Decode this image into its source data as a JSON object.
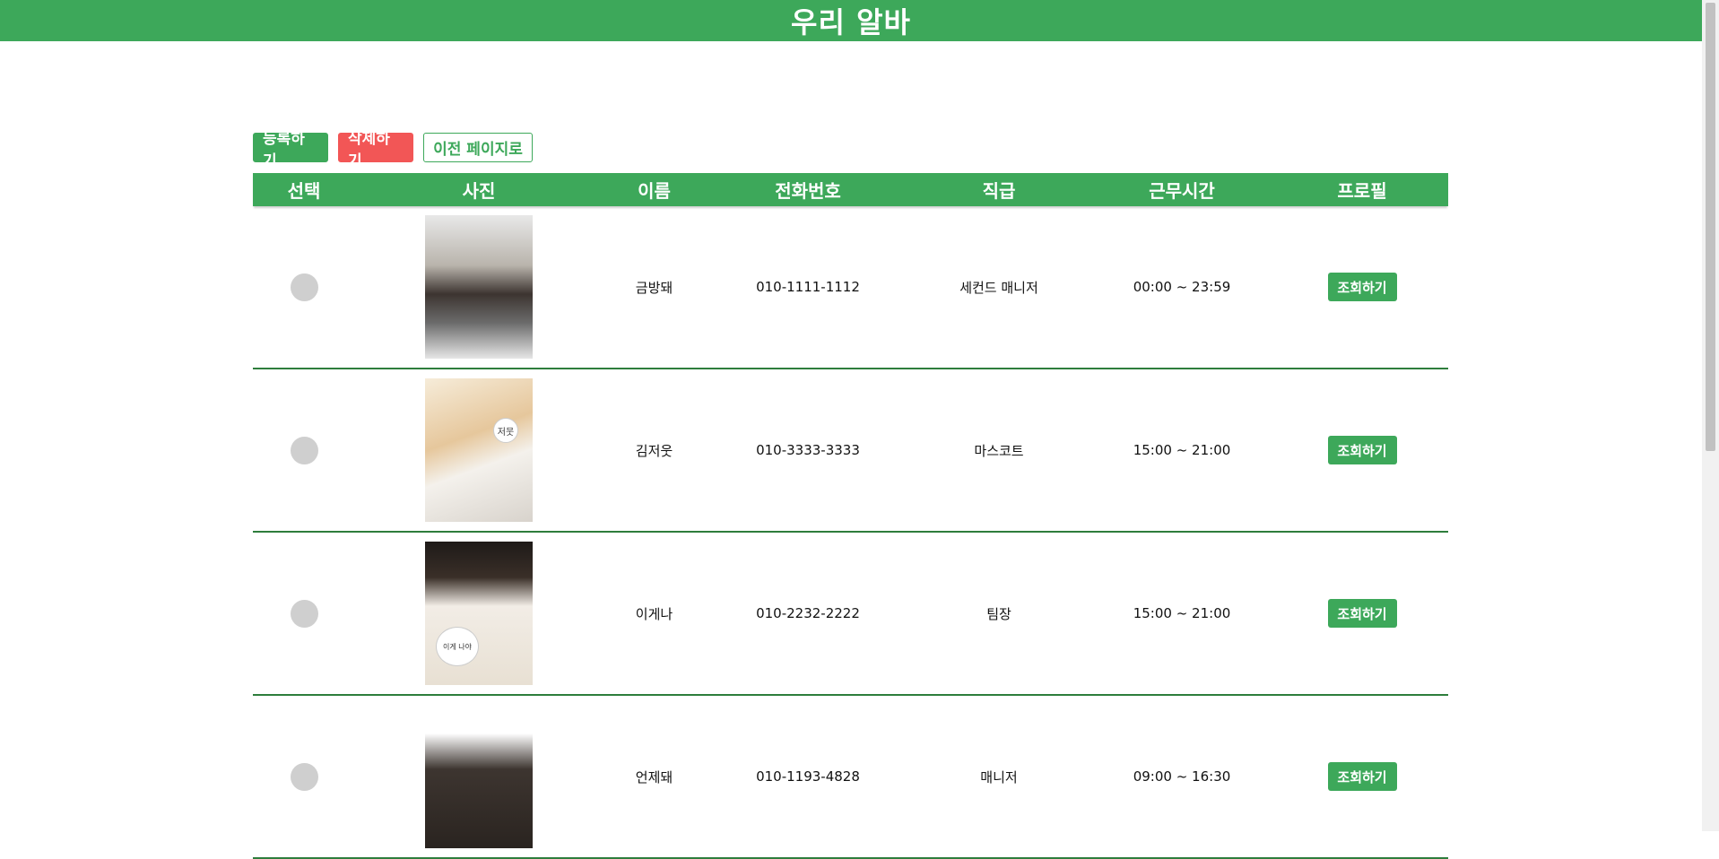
{
  "header": {
    "title": "우리 알바"
  },
  "actions": {
    "register": "등록하기",
    "delete": "삭제하기",
    "back": "이전 페이지로"
  },
  "table": {
    "columns": [
      "선택",
      "사진",
      "이름",
      "전화번호",
      "직급",
      "근무시간",
      "프로필"
    ],
    "rows": [
      {
        "name": "금방돼",
        "phone": "010-1111-1112",
        "position": "세컨드 매니저",
        "hours": "00:00 ~ 23:59",
        "view": "조회하기"
      },
      {
        "name": "김저웃",
        "phone": "010-3333-3333",
        "position": "마스코트",
        "hours": "15:00 ~ 21:00",
        "view": "조회하기",
        "photo_caption": "저뭇"
      },
      {
        "name": "이게나",
        "phone": "010-2232-2222",
        "position": "팀장",
        "hours": "15:00 ~ 21:00",
        "view": "조회하기",
        "photo_caption": "이게 나야"
      },
      {
        "name": "언제돼",
        "phone": "010-1193-4828",
        "position": "매니저",
        "hours": "09:00 ~ 16:30",
        "view": "조회하기"
      }
    ]
  },
  "colors": {
    "brand_green": "#3da85a",
    "danger_red": "#f25656",
    "radio_gray": "#cfcfcf"
  }
}
